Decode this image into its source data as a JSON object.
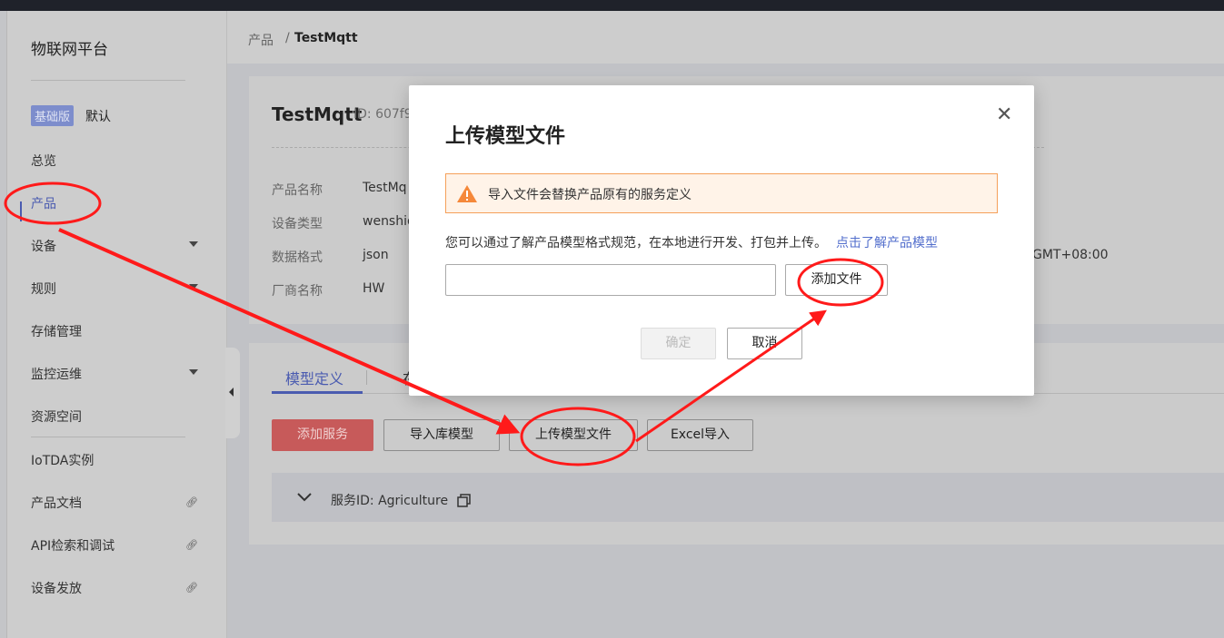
{
  "sidebar": {
    "brand": "物联网平台",
    "edition_badge": "基础版",
    "edition_name": "默认",
    "items": [
      {
        "label": "总览"
      },
      {
        "label": "产品",
        "active": true
      },
      {
        "label": "设备",
        "expandable": true
      },
      {
        "label": "规则",
        "expandable": true
      },
      {
        "label": "存储管理"
      },
      {
        "label": "监控运维",
        "expandable": true
      },
      {
        "label": "资源空间"
      },
      {
        "label": "IoTDA实例"
      },
      {
        "label": "产品文档",
        "external": true
      },
      {
        "label": "API检索和调试",
        "external": true
      },
      {
        "label": "设备发放",
        "external": true
      }
    ]
  },
  "breadcrumb": {
    "parent": "产品",
    "separator": "/",
    "current": "TestMqtt"
  },
  "product": {
    "name": "TestMqtt",
    "id": "ID: 607f9",
    "fields": [
      {
        "label": "产品名称",
        "value": "TestMq"
      },
      {
        "label": "设备类型",
        "value": "wenshid"
      },
      {
        "label": "数据格式",
        "value": "json"
      },
      {
        "label": "厂商名称",
        "value": "HW"
      }
    ],
    "timezone_fragment": "GMT+08:00"
  },
  "tabs": [
    {
      "label": "模型定义",
      "active": true
    },
    {
      "label": "在"
    }
  ],
  "toolbar": {
    "add_service": "添加服务",
    "import_library": "导入库模型",
    "upload_model": "上传模型文件",
    "excel_import": "Excel导入"
  },
  "service": {
    "label": "服务ID: Agriculture"
  },
  "modal": {
    "title": "上传模型文件",
    "alert": "导入文件会替换产品原有的服务定义",
    "description": "您可以通过了解产品模型格式规范，在本地进行开发、打包并上传。",
    "learn_link": "点击了解产品模型",
    "file_input_value": "",
    "add_file": "添加文件",
    "confirm": "确定",
    "cancel": "取消"
  },
  "colors": {
    "accent": "#526ecc",
    "primary_red": "#c75a5a",
    "annotation": "#ff1a1a",
    "warning": "#f5883a"
  }
}
